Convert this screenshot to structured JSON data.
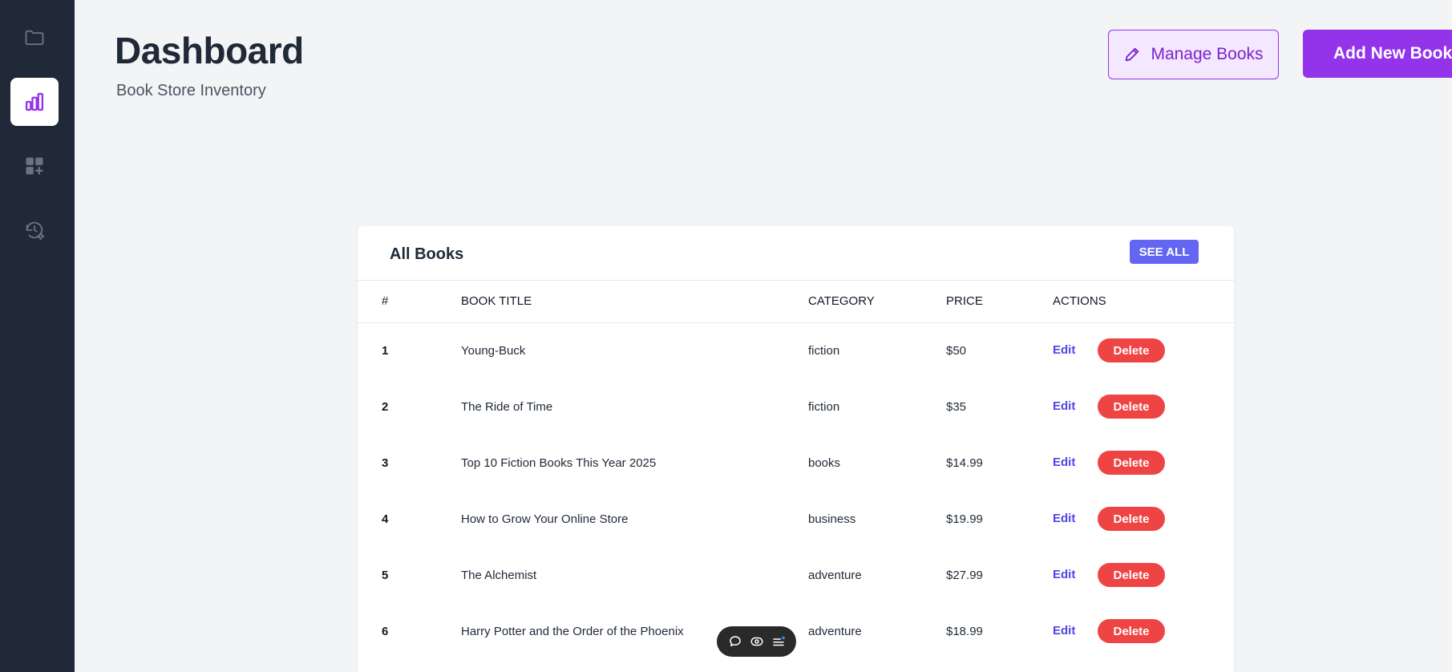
{
  "header": {
    "title": "Dashboard",
    "subtitle": "Book Store Inventory",
    "manage_label": "Manage Books",
    "add_label": "Add New Book"
  },
  "sidebar": {
    "items": [
      {
        "icon": "folder-icon",
        "active": false
      },
      {
        "icon": "bar-chart-icon",
        "active": true
      },
      {
        "icon": "add-widget-icon",
        "active": false
      },
      {
        "icon": "history-settings-icon",
        "active": false
      }
    ]
  },
  "card": {
    "title": "All Books",
    "see_all_label": "SEE ALL",
    "columns": [
      "#",
      "BOOK TITLE",
      "CATEGORY",
      "PRICE",
      "ACTIONS"
    ],
    "rows": [
      {
        "idx": "1",
        "title": "Young-Buck",
        "category": "fiction",
        "price": "$50"
      },
      {
        "idx": "2",
        "title": "The Ride of Time",
        "category": "fiction",
        "price": "$35"
      },
      {
        "idx": "3",
        "title": "Top 10 Fiction Books This Year 2025",
        "category": "books",
        "price": "$14.99"
      },
      {
        "idx": "4",
        "title": "How to Grow Your Online Store",
        "category": "business",
        "price": "$19.99"
      },
      {
        "idx": "5",
        "title": "The Alchemist",
        "category": "adventure",
        "price": "$27.99"
      },
      {
        "idx": "6",
        "title": "Harry Potter and the Order of the Phoenix",
        "category": "adventure",
        "price": "$18.99"
      }
    ],
    "edit_label": "Edit",
    "delete_label": "Delete"
  },
  "colors": {
    "sidebar_bg": "#1f2937",
    "accent_purple": "#9333ea",
    "see_all_indigo": "#6366f1",
    "delete_red": "#ef4444",
    "page_bg": "#f3f4f6"
  }
}
